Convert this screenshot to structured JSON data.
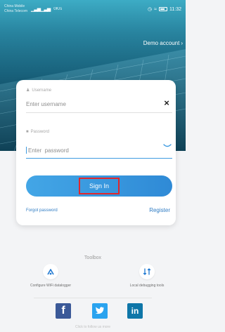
{
  "status_bar": {
    "carrier_line1": "China Mobile",
    "carrier_line2": "China Telecom",
    "signal": "▁▃▅ ▁▃▅",
    "net_speed": "0K/s",
    "clock": "11:32"
  },
  "header": {
    "demo_account_label": "Demo account"
  },
  "login": {
    "username_label": "Username",
    "username_placeholder": "Enter username",
    "password_label": "Password",
    "password_placeholder": "Enter  password",
    "sign_in_label": "Sign In",
    "forgot_password_label": "Forgot password",
    "register_label": "Register"
  },
  "toolbox": {
    "title": "Toolbox",
    "tools": [
      {
        "label": "Configure WiFi datalogger",
        "icon": "wifi-config-icon"
      },
      {
        "label": "Local debugging tools",
        "icon": "debug-tools-icon"
      }
    ]
  },
  "social": {
    "items": [
      {
        "icon": "facebook-icon"
      },
      {
        "icon": "twitter-icon"
      },
      {
        "icon": "linkedin-icon"
      }
    ]
  },
  "footer": {
    "text": "Click to follow us more"
  },
  "colors": {
    "accent": "#3e9be0",
    "sign_in_button": "#3a9ae2",
    "highlight_box": "#e2262b",
    "link": "#2f7cc4"
  }
}
